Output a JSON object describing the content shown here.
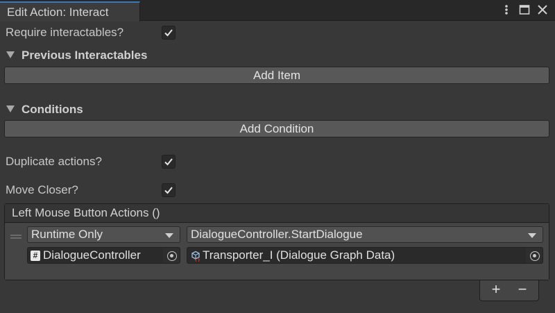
{
  "window": {
    "tab_title": "Edit Action: Interact",
    "controls": [
      "kebab-menu-icon",
      "maximize-icon",
      "close-icon"
    ]
  },
  "fields": {
    "require_interactables": {
      "label": "Require interactables?",
      "checked": true
    },
    "duplicate_actions": {
      "label": "Duplicate actions?",
      "checked": true
    },
    "move_closer": {
      "label": "Move Closer?",
      "checked": true
    }
  },
  "previous_interactables": {
    "title": "Previous Interactables",
    "expanded": true,
    "button_label": "Add Item"
  },
  "conditions": {
    "title": "Conditions",
    "expanded": true,
    "button_label": "Add Condition"
  },
  "event": {
    "header": "Left Mouse Button Actions ()",
    "entry": {
      "call_state": "Runtime Only",
      "function": "DialogueController.StartDialogue",
      "target_object": "DialogueController",
      "target_icon": "#",
      "argument": "Transporter_I (Dialogue Graph Data)"
    },
    "add_label": "+",
    "remove_label": "−"
  },
  "colors": {
    "background": "#383838",
    "tab_accent": "#3a79bb",
    "button": "#585858",
    "field": "#2a2a2a"
  }
}
